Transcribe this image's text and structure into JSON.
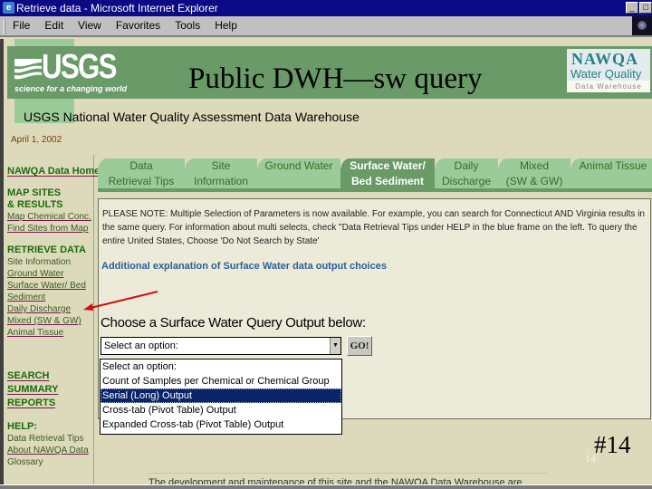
{
  "window": {
    "title": "Retrieve data - Microsoft Internet Explorer",
    "icon": "ie-icon",
    "controls": [
      "minimize",
      "maximize"
    ]
  },
  "menubar": {
    "items": [
      "File",
      "Edit",
      "View",
      "Favorites",
      "Tools",
      "Help"
    ]
  },
  "header": {
    "usgs_word": "USGS",
    "usgs_tagline": "science for a changing world",
    "slide_title": "Public DWH—sw query",
    "nawqa_line1": "NAWQA",
    "nawqa_line2": "Water Quality",
    "nawqa_line3": "Data Warehouse",
    "subtitle": "USGS National Water Quality Assessment Data Warehouse",
    "date": "April 1, 2002"
  },
  "sidebar": {
    "home": "NAWQA Data Home",
    "map_section": "MAP SITES & RESULTS",
    "map_links": [
      "Map Chemical Conc.",
      "Find Sites from Map"
    ],
    "retrieve_section": "RETRIEVE DATA",
    "retrieve_links": [
      "Site Information",
      "Ground Water",
      "Surface Water/ Bed Sediment",
      "Daily Discharge",
      "Mixed (SW & GW)",
      "Animal Tissue"
    ],
    "search_section": [
      "SEARCH",
      "SUMMARY",
      "REPORTS"
    ],
    "help_section": "HELP:",
    "help_links": [
      "Data Retrieval Tips",
      "About NAWQA Data",
      "Glossary"
    ]
  },
  "tabs": [
    {
      "line1": "Data",
      "line2": "Retrieval Tips",
      "active": false
    },
    {
      "line1": "Site",
      "line2": "Information",
      "active": false
    },
    {
      "line1": "Ground Water",
      "line2": "",
      "active": false
    },
    {
      "line1": "Surface Water/",
      "line2": "Bed Sediment",
      "active": true
    },
    {
      "line1": "Daily",
      "line2": "Discharge",
      "active": false
    },
    {
      "line1": "Mixed",
      "line2": "(SW & GW)",
      "active": false
    },
    {
      "line1": "Animal Tissue",
      "line2": "",
      "active": false
    }
  ],
  "content": {
    "notice": "PLEASE NOTE: Multiple Selection of Parameters is now available. For example, you can search for Connecticut AND Virginia results in the same query. For information about multi selects, check \"Data Retrieval Tips under HELP in the blue frame on the left. To query the entire United States, Choose 'Do Not Search by State'",
    "additional_link": "Additional explanation of Surface Water data output choices",
    "choose_label": "Choose a Surface Water Query Output below:",
    "select_value": "Select an option:",
    "go_button": "GO!",
    "options": [
      "Select an option:",
      "Count of Samples per Chemical or Chemical Group",
      "Serial (Long) Output",
      "Cross-tab (Pivot Table) Output",
      "Expanded Cross-tab (Pivot Table) Output"
    ],
    "highlighted_option_index": 2
  },
  "footer": {
    "slide_number_small": "14",
    "slide_number": "#14",
    "text": "The development and maintenance of this site and the NAWQA Data Warehouse are"
  },
  "colors": {
    "banner_green": "#6a9a68",
    "tab_green": "#9ccb9a",
    "page_bg": "#dcdabb",
    "link_blue": "#2f5e96",
    "selection_navy": "#0a246a",
    "annotation_red": "#d01010"
  }
}
